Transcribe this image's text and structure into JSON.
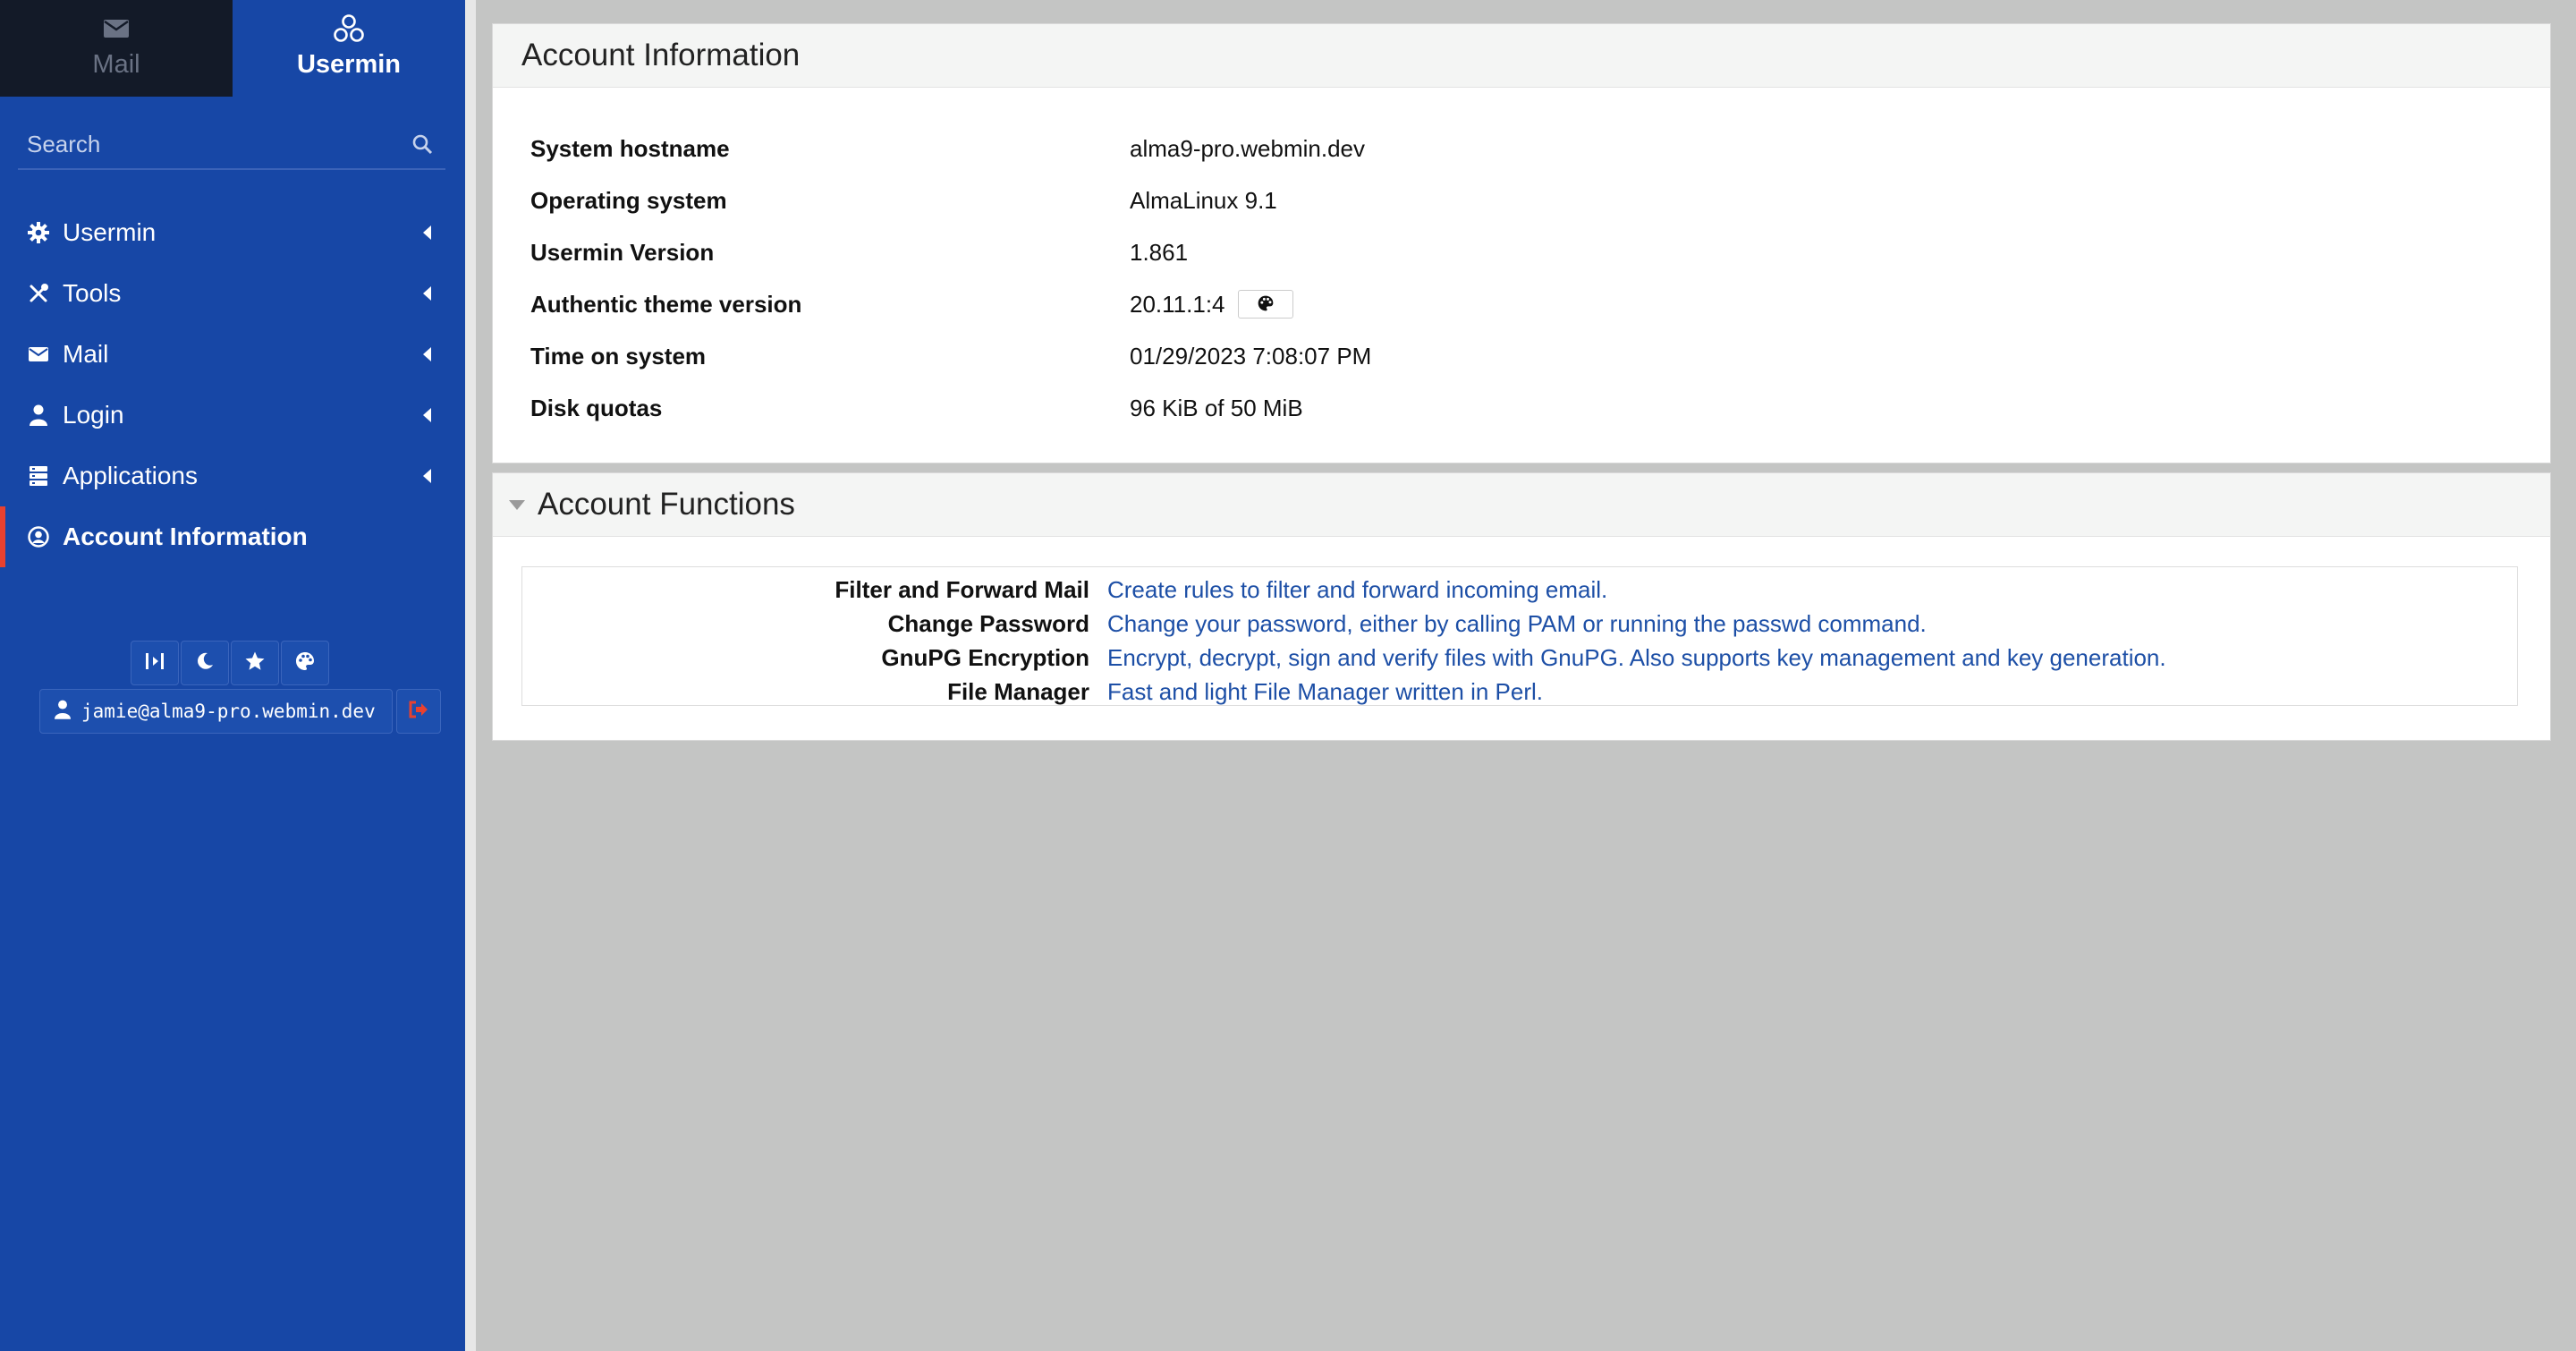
{
  "sidebar": {
    "switcher": {
      "mail_label": "Mail",
      "usermin_label": "Usermin"
    },
    "search": {
      "placeholder": "Search"
    },
    "items": [
      {
        "label": "Usermin",
        "icon": "gear-icon"
      },
      {
        "label": "Tools",
        "icon": "tools-icon"
      },
      {
        "label": "Mail",
        "icon": "envelope-icon"
      },
      {
        "label": "Login",
        "icon": "user-icon"
      },
      {
        "label": "Applications",
        "icon": "server-icon"
      },
      {
        "label": "Account Information",
        "icon": "user-circle-icon",
        "active": true
      }
    ],
    "quick_icons": [
      "collapse-icon",
      "moon-icon",
      "star-icon",
      "palette-icon"
    ],
    "user": "jamie@alma9-pro.webmin.dev"
  },
  "account_info": {
    "title": "Account Information",
    "rows": [
      {
        "label": "System hostname",
        "value": "alma9-pro.webmin.dev"
      },
      {
        "label": "Operating system",
        "value": "AlmaLinux 9.1"
      },
      {
        "label": "Usermin Version",
        "value": "1.861"
      },
      {
        "label": "Authentic theme version",
        "value": "20.11.1:4"
      },
      {
        "label": "Time on system",
        "value": "01/29/2023 7:08:07 PM"
      },
      {
        "label": "Disk quotas",
        "value": "96 KiB of 50 MiB"
      }
    ]
  },
  "account_functions": {
    "title": "Account Functions",
    "rows": [
      {
        "label": "Filter and Forward Mail",
        "desc": "Create rules to filter and forward incoming email."
      },
      {
        "label": "Change Password",
        "desc": "Change your password, either by calling PAM or running the passwd command."
      },
      {
        "label": "GnuPG Encryption",
        "desc": "Encrypt, decrypt, sign and verify files with GnuPG. Also supports key management and key generation."
      },
      {
        "label": "File Manager",
        "desc": "Fast and light File Manager written in Perl."
      }
    ]
  },
  "colors": {
    "sidebar": "#1747a6",
    "link": "#1d4fa6",
    "active_marker": "#e8412f"
  }
}
